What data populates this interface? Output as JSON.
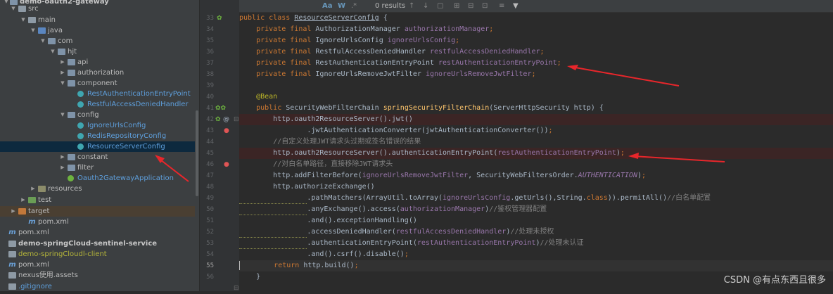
{
  "project_tree": {
    "root_label": "demo-oauth2-gateway",
    "items": [
      {
        "label": "src",
        "icon": "folder-icon",
        "expanded": true
      },
      {
        "label": "main",
        "icon": "folder-icon",
        "expanded": true
      },
      {
        "label": "java",
        "icon": "source-folder-icon",
        "expanded": true
      },
      {
        "label": "com",
        "icon": "package-icon",
        "expanded": true
      },
      {
        "label": "hjt",
        "icon": "package-icon",
        "expanded": true
      },
      {
        "label": "api",
        "icon": "package-icon",
        "expanded": false
      },
      {
        "label": "authorization",
        "icon": "package-icon",
        "expanded": false
      },
      {
        "label": "component",
        "icon": "package-icon",
        "expanded": true
      },
      {
        "label": "RestAuthenticationEntryPoint",
        "icon": "class-icon"
      },
      {
        "label": "RestfulAccessDeniedHandler",
        "icon": "class-icon"
      },
      {
        "label": "config",
        "icon": "package-icon",
        "expanded": true
      },
      {
        "label": "IgnoreUrlsConfig",
        "icon": "class-icon"
      },
      {
        "label": "RedisRepositoryConfig",
        "icon": "class-icon"
      },
      {
        "label": "ResourceServerConfig",
        "icon": "class-icon",
        "selected": true
      },
      {
        "label": "constant",
        "icon": "package-icon",
        "expanded": false
      },
      {
        "label": "filter",
        "icon": "package-icon",
        "expanded": false
      },
      {
        "label": "Oauth2GatewayApplication",
        "icon": "spring-boot-icon"
      },
      {
        "label": "resources",
        "icon": "resources-folder-icon",
        "expanded": false
      },
      {
        "label": "test",
        "icon": "test-folder-icon",
        "expanded": false
      },
      {
        "label": "target",
        "icon": "target-folder-icon",
        "expanded": false
      },
      {
        "label": "pom.xml",
        "icon": "maven-icon"
      },
      {
        "label": "pom.xml",
        "icon": "maven-icon"
      },
      {
        "label": "demo-springCloud-sentinel-service",
        "icon": "module-folder-icon"
      },
      {
        "label": "demo-springCloudl-client",
        "icon": "module-folder-icon"
      },
      {
        "label": "pom.xml",
        "icon": "maven-icon"
      },
      {
        "label": "nexus使用.assets",
        "icon": "folder-icon"
      },
      {
        "label": ".gitignore",
        "icon": "gitignore-icon"
      }
    ]
  },
  "find_bar": {
    "results_label": "0 results",
    "match_case": "Aa",
    "words": "W",
    "regex": ".*"
  },
  "line_numbers": [
    "33",
    "34",
    "35",
    "36",
    "37",
    "38",
    "39",
    "40",
    "41",
    "42",
    "43",
    "44",
    "45",
    "46",
    "47",
    "48",
    "49",
    "50",
    "51",
    "52",
    "53",
    "54",
    "55",
    "56"
  ],
  "code_lines": [
    "public class ResourceServerConfig {",
    "    private final AuthorizationManager authorizationManager;",
    "    private final IgnoreUrlsConfig ignoreUrlsConfig;",
    "    private final RestfulAccessDeniedHandler restfulAccessDeniedHandler;",
    "    private final RestAuthenticationEntryPoint restAuthenticationEntryPoint;",
    "    private final IgnoreUrlsRemoveJwtFilter ignoreUrlsRemoveJwtFilter;",
    "",
    "    @Bean",
    "    public SecurityWebFilterChain springSecurityFilterChain(ServerHttpSecurity http) {",
    "        http.oauth2ResourceServer().jwt()",
    "                .jwtAuthenticationConverter(jwtAuthenticationConverter());",
    "        //自定义处理JWT请求头过期或签名错误的结果",
    "        http.oauth2ResourceServer().authenticationEntryPoint(restAuthenticationEntryPoint);",
    "        //对白名单路径，直接移除JWT请求头",
    "        http.addFilterBefore(ignoreUrlsRemoveJwtFilter, SecurityWebFiltersOrder.AUTHENTICATION);",
    "        http.authorizeExchange()",
    "                .pathMatchers(ArrayUtil.toArray(ignoreUrlsConfig.getUrls(),String.class)).permitAll()//白名单配置",
    "                .anyExchange().access(authorizationManager)//鉴权管理器配置",
    "                .and().exceptionHandling()",
    "                .accessDeniedHandler(restfulAccessDeniedHandler)//处理未授权",
    "                .authenticationEntryPoint(restAuthenticationEntryPoint)//处理未认证",
    "                .and().csrf().disable();",
    "        return http.build();",
    "    }"
  ],
  "watermark": "CSDN @有点东西且很多",
  "colors": {
    "keyword": "#cc7832",
    "field": "#9876aa",
    "method": "#ffc66d",
    "annotation": "#bbb529",
    "comment": "#808080",
    "text": "#a9b7c6",
    "arrow": "#e8262b"
  }
}
